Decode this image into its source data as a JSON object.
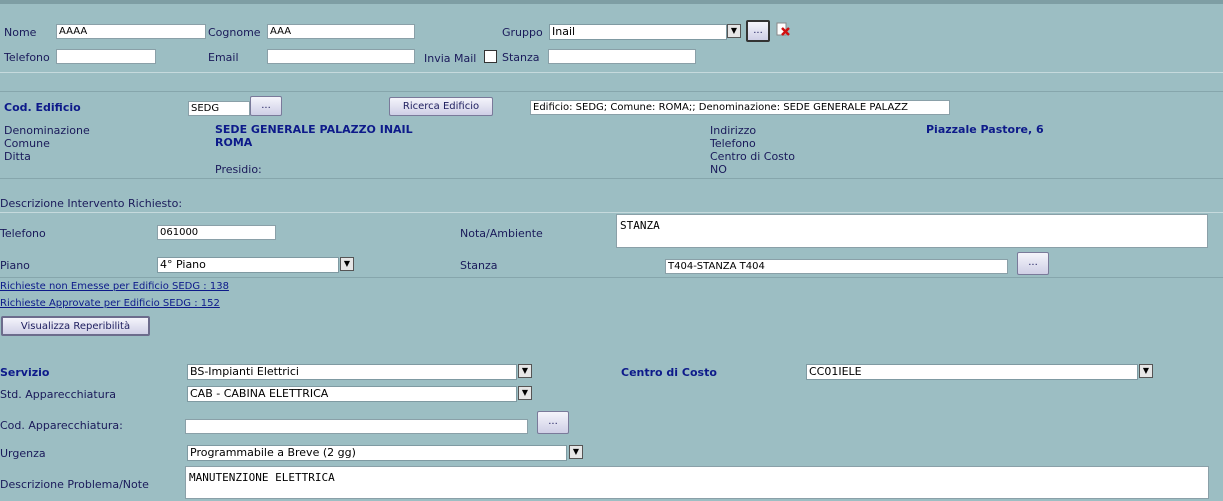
{
  "header": {
    "nome_label": "Nome",
    "nome_value": "AAAA",
    "cognome_label": "Cognome",
    "cognome_value": "AAA",
    "gruppo_label": "Gruppo",
    "gruppo_value": "Inail",
    "telefono_label": "Telefono",
    "telefono_value": "",
    "email_label": "Email",
    "email_value": "",
    "invia_mail_label": "Invia Mail",
    "stanza_label": "Stanza",
    "stanza_value": "",
    "browse_label": "..."
  },
  "edificio": {
    "cod_label": "Cod. Edificio",
    "cod_value": "SEDG",
    "browse_label": "...",
    "ricerca_button": "Ricerca Edificio",
    "summary": "Edificio: SEDG; Comune: ROMA;; Denominazione: SEDE GENERALE PALAZZ",
    "denominazione_label": "Denominazione",
    "denominazione_value": "SEDE GENERALE PALAZZO INAIL",
    "comune_label": "Comune",
    "comune_value": "ROMA",
    "ditta_label": "Ditta",
    "presidio_label": "Presidio:",
    "indirizzo_label": "Indirizzo",
    "indirizzo_value": "Piazzale Pastore, 6",
    "telefono_label": "Telefono",
    "centro_label": "Centro di Costo",
    "no_value": "NO"
  },
  "intervento": {
    "descr_label": "Descrizione Intervento Richiesto:",
    "telefono_label": "Telefono",
    "telefono_value": "061000",
    "nota_label": "Nota/Ambiente",
    "nota_value": "STANZA",
    "piano_label": "Piano",
    "piano_value": "4° Piano",
    "stanza_label": "Stanza",
    "stanza_value": "T404-STANZA T404",
    "browse_label": "...",
    "link1": "Richieste non Emesse per Edificio SEDG : 138",
    "link2": "Richieste Approvate per Edificio SEDG : 152",
    "reperibilita_button": "Visualizza Reperibilità"
  },
  "servizio": {
    "servizio_label": "Servizio",
    "servizio_value": "BS-Impianti Elettrici",
    "centro_label": "Centro di Costo",
    "centro_value": "CC01IELE",
    "std_label": "Std. Apparecchiatura",
    "std_value": "CAB - CABINA ELETTRICA",
    "cod_label": "Cod. Apparecchiatura:",
    "cod_value": "",
    "browse_label": "...",
    "urgenza_label": "Urgenza",
    "urgenza_value": "Programmabile a Breve (2 gg)",
    "descr_label": "Descrizione Problema/Note",
    "descr_value": "MANUTENZIONE ELETTRICA"
  },
  "colors": {
    "background": "#9cbec3",
    "label": "#1a1a5a",
    "bold_label": "#0d1a8a"
  }
}
